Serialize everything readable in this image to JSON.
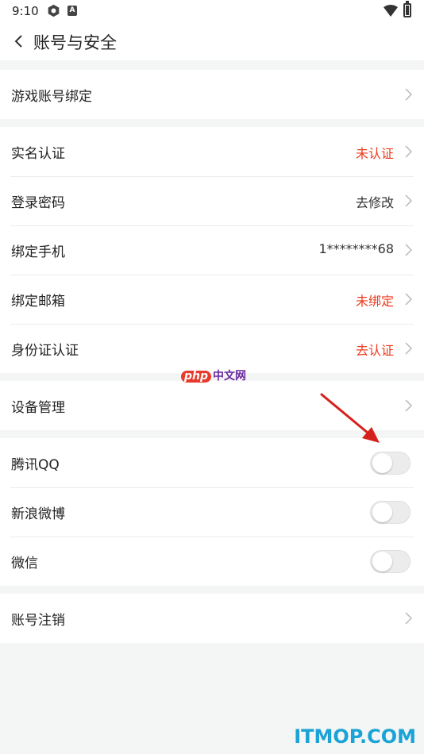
{
  "status_bar": {
    "time": "9:10",
    "indicator_letter": "A"
  },
  "nav": {
    "title": "账号与安全"
  },
  "sections": [
    {
      "rows": [
        {
          "label": "游戏账号绑定"
        }
      ]
    },
    {
      "rows": [
        {
          "label": "实名认证",
          "value": "未认证"
        },
        {
          "label": "登录密码",
          "value": "去修改"
        },
        {
          "label": "绑定手机",
          "value": "1********68"
        },
        {
          "label": "绑定邮箱",
          "value": "未绑定"
        },
        {
          "label": "身份证认证",
          "value": "去认证"
        }
      ]
    },
    {
      "rows": [
        {
          "label": "设备管理"
        }
      ]
    },
    {
      "rows": [
        {
          "label": "腾讯QQ",
          "toggle": false
        },
        {
          "label": "新浪微博",
          "toggle": false
        },
        {
          "label": "微信",
          "toggle": false
        }
      ]
    },
    {
      "rows": [
        {
          "label": "账号注销"
        }
      ]
    }
  ],
  "watermark": {
    "php": "php",
    "site": "中文网"
  },
  "footer": {
    "brand": "ITMOP.COM"
  },
  "colors": {
    "warn": "#ee3b1e",
    "brand": "#1aa3d6",
    "arrow": "#d6201c"
  },
  "icons": [
    "gear-icon",
    "a-icon",
    "wifi-icon",
    "battery-icon",
    "back-icon",
    "chevron-right-icon"
  ]
}
